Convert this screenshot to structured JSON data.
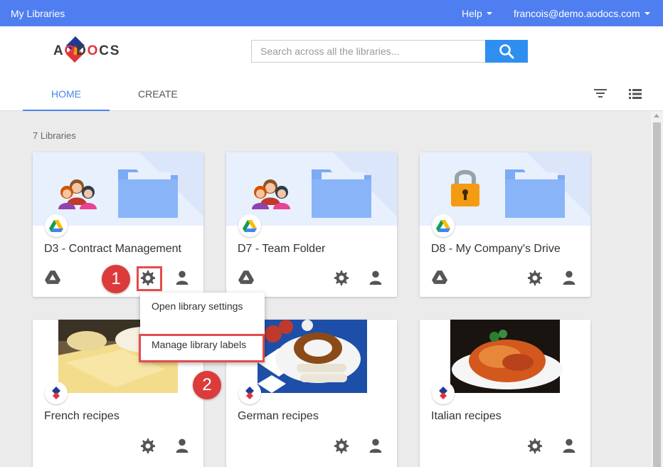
{
  "topbar": {
    "app_title": "My Libraries",
    "help": "Help",
    "user": "francois@demo.aodocs.com"
  },
  "header": {
    "logo": "AODOCS",
    "search_placeholder": "Search across all the libraries..."
  },
  "tabs": [
    {
      "label": "HOME",
      "active": true
    },
    {
      "label": "CREATE",
      "active": false
    }
  ],
  "library_count": "7 Libraries",
  "cards": [
    {
      "title": "D3 - Contract Management",
      "banner": "people-folder",
      "badge": "google-drive"
    },
    {
      "title": "D7 - Team Folder",
      "banner": "people-folder",
      "badge": "google-drive"
    },
    {
      "title": "D8 - My Company's Drive",
      "banner": "lock-folder",
      "badge": "google-drive"
    },
    {
      "title": "French recipes",
      "banner": "cheese-photo",
      "badge": "aodocs"
    },
    {
      "title": "German recipes",
      "banner": "pretzel-photo",
      "badge": "aodocs"
    },
    {
      "title": "Italian recipes",
      "banner": "spaghetti-photo",
      "badge": "aodocs"
    }
  ],
  "menu": {
    "item1": "Open library settings",
    "item2": "Manage library labels"
  },
  "steps": {
    "one": "1",
    "two": "2"
  },
  "colors": {
    "topbar": "#4f7ef0",
    "accent": "#4a86e8",
    "search_button": "#2f8ff0",
    "callout": "#dd3b3b"
  }
}
